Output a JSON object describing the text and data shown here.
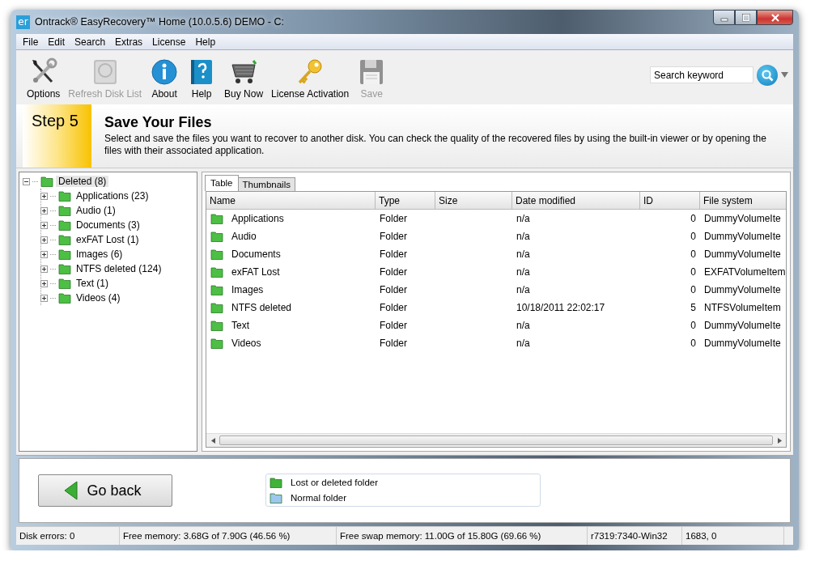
{
  "window": {
    "app_icon": "er",
    "title": "Ontrack® EasyRecovery™ Home (10.0.5.6) DEMO - C:"
  },
  "menu": [
    "File",
    "Edit",
    "Search",
    "Extras",
    "License",
    "Help"
  ],
  "toolbar": {
    "items": [
      {
        "label": "Options",
        "kind": "options",
        "disabled": false
      },
      {
        "label": "Refresh Disk List",
        "kind": "disk",
        "disabled": true
      },
      {
        "label": "About",
        "kind": "info",
        "disabled": false
      },
      {
        "label": "Help",
        "kind": "help",
        "disabled": false
      },
      {
        "label": "Buy Now",
        "kind": "cart",
        "disabled": false
      },
      {
        "label": "License Activation",
        "kind": "key",
        "disabled": false
      },
      {
        "label": "Save",
        "kind": "save",
        "disabled": true
      }
    ],
    "search": {
      "placeholder": "Search keyword"
    }
  },
  "step": {
    "badge": "Step 5",
    "title": "Save Your Files",
    "description": "Select and save the files you want to recover to another disk. You can check the quality of the recovered files by using the built-in viewer or by opening the files with their associated application."
  },
  "tree": {
    "label": "Deleted (8)",
    "expanded": true,
    "selected": true,
    "children": [
      {
        "label": "Applications (23)",
        "expanded": false,
        "selected": false
      },
      {
        "label": "Audio (1)",
        "expanded": false,
        "selected": false
      },
      {
        "label": "Documents (3)",
        "expanded": false,
        "selected": false
      },
      {
        "label": "exFAT Lost (1)",
        "expanded": false,
        "selected": false
      },
      {
        "label": "Images (6)",
        "expanded": false,
        "selected": false
      },
      {
        "label": "NTFS deleted (124)",
        "expanded": false,
        "selected": false
      },
      {
        "label": "Text (1)",
        "expanded": false,
        "selected": false
      },
      {
        "label": "Videos (4)",
        "expanded": false,
        "selected": false
      }
    ]
  },
  "tabs": [
    {
      "label": "Table",
      "selected": true
    },
    {
      "label": "Thumbnails",
      "selected": false
    }
  ],
  "table": {
    "columns": [
      "Name",
      "Type",
      "Size",
      "Date modified",
      "ID",
      "File system"
    ],
    "rows": [
      {
        "name": "Applications",
        "type": "Folder",
        "date_modified": "n/a",
        "id": "0",
        "file_system": "DummyVolumeIte"
      },
      {
        "name": "Audio",
        "type": "Folder",
        "date_modified": "n/a",
        "id": "0",
        "file_system": "DummyVolumeIte"
      },
      {
        "name": "Documents",
        "type": "Folder",
        "date_modified": "n/a",
        "id": "0",
        "file_system": "DummyVolumeIte"
      },
      {
        "name": "exFAT Lost",
        "type": "Folder",
        "date_modified": "n/a",
        "id": "0",
        "file_system": "EXFATVolumeItem"
      },
      {
        "name": "Images",
        "type": "Folder",
        "date_modified": "n/a",
        "id": "0",
        "file_system": "DummyVolumeIte"
      },
      {
        "name": "NTFS deleted",
        "type": "Folder",
        "date_modified": "10/18/2011 22:02:17",
        "id": "5",
        "file_system": "NTFSVolumeItem"
      },
      {
        "name": "Text",
        "type": "Folder",
        "date_modified": "n/a",
        "id": "0",
        "file_system": "DummyVolumeIte"
      },
      {
        "name": "Videos",
        "type": "Folder",
        "date_modified": "n/a",
        "id": "0",
        "file_system": "DummyVolumeIte"
      }
    ]
  },
  "go_back": "Go back",
  "legend": [
    {
      "label": "Lost or deleted folder",
      "color": "#3fb33a"
    },
    {
      "label": "Normal folder",
      "color": "#9cc8ef"
    }
  ],
  "status_bar": [
    "Disk errors: 0",
    "Free memory: 3.68G of 7.90G (46.56 %)",
    "Free swap memory: 11.00G of 15.80G (69.66 %)",
    "r7319:7340-Win32",
    "1683, 0"
  ]
}
